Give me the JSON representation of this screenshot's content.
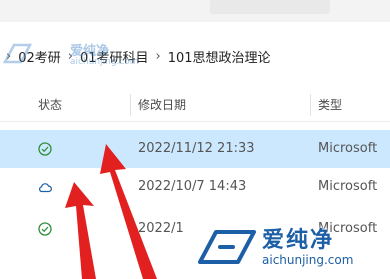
{
  "breadcrumb": {
    "items": [
      "02考研",
      "01考研科目",
      "101思想政治理论"
    ],
    "separator": "›"
  },
  "columns": {
    "status": "状态",
    "modified": "修改日期",
    "type": "类型"
  },
  "rows": [
    {
      "status_icon": "sync-check-icon",
      "modified": "2022/11/12 21:33",
      "type": "Microsoft",
      "selected": true
    },
    {
      "status_icon": "cloud-icon",
      "modified": "2022/10/7 14:43",
      "type": "Microsoft",
      "selected": false
    },
    {
      "status_icon": "sync-check-icon",
      "modified": "2022/1",
      "type": "Microsoft",
      "selected": false
    }
  ],
  "watermark": {
    "name": "爱纯净",
    "url": "aichunjing.com",
    "colors": {
      "primary": "#1d5fa6"
    }
  },
  "colors": {
    "selection": "#cce8ff",
    "status_green": "#2f8f3a",
    "cloud_blue": "#1a5fa8",
    "arrow_red": "#e32020"
  }
}
